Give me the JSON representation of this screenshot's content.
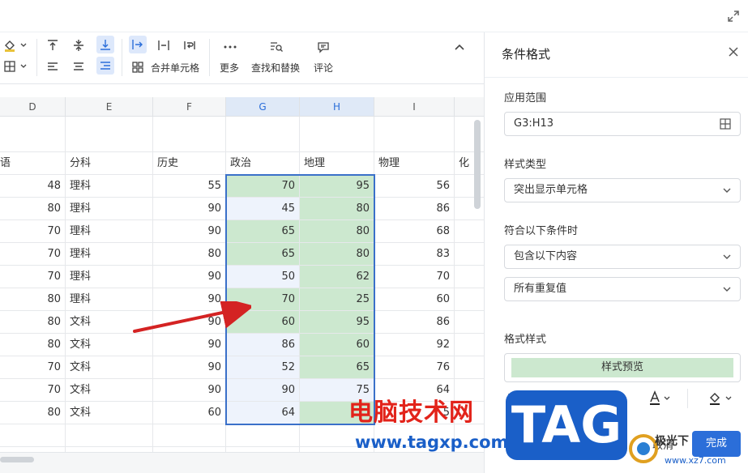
{
  "toolbar": {
    "merge_cells": "合并单元格",
    "more": "更多",
    "find_replace": "查找和替换",
    "comment": "评论"
  },
  "grid": {
    "columns": [
      "D",
      "E",
      "F",
      "G",
      "H",
      "I"
    ],
    "headers": [
      "语",
      "分科",
      "历史",
      "政治",
      "地理",
      "物理",
      "化"
    ],
    "rows": [
      [
        "48",
        "理科",
        "55",
        "70",
        "95",
        "56"
      ],
      [
        "80",
        "理科",
        "90",
        "45",
        "80",
        "86"
      ],
      [
        "70",
        "理科",
        "90",
        "65",
        "80",
        "68"
      ],
      [
        "70",
        "理科",
        "80",
        "65",
        "80",
        "83"
      ],
      [
        "70",
        "理科",
        "90",
        "50",
        "62",
        "70"
      ],
      [
        "80",
        "理科",
        "90",
        "70",
        "25",
        "60"
      ],
      [
        "80",
        "文科",
        "90",
        "60",
        "95",
        "86"
      ],
      [
        "80",
        "文科",
        "90",
        "86",
        "60",
        "92"
      ],
      [
        "70",
        "文科",
        "90",
        "52",
        "65",
        "76"
      ],
      [
        "70",
        "文科",
        "90",
        "90",
        "75",
        "64"
      ],
      [
        "80",
        "文科",
        "60",
        "64",
        "",
        "5"
      ]
    ],
    "highlight_g": [
      true,
      false,
      true,
      true,
      false,
      true,
      true,
      false,
      false,
      false,
      false
    ],
    "highlight_h": [
      true,
      true,
      true,
      true,
      true,
      true,
      true,
      true,
      true,
      false,
      true
    ]
  },
  "panel": {
    "title": "条件格式",
    "range_label": "应用范围",
    "range_value": "G3:H13",
    "style_type_label": "样式类型",
    "style_type_value": "突出显示单元格",
    "condition_label": "符合以下条件时",
    "condition_value": "包含以下内容",
    "condition_sub_value": "所有重复值",
    "format_label": "格式样式",
    "preview_text": "样式预览",
    "cancel": "取消",
    "done": "完成"
  },
  "colors": {
    "highlight": "#cce8cf",
    "accent": "#2b6ed9",
    "arrow": "#d42323"
  },
  "watermark": {
    "text": "电脑技术网",
    "url": "www.tagxp.com",
    "tag": "TAG",
    "side": "极光下",
    "side_url": "www.xz7.com"
  }
}
